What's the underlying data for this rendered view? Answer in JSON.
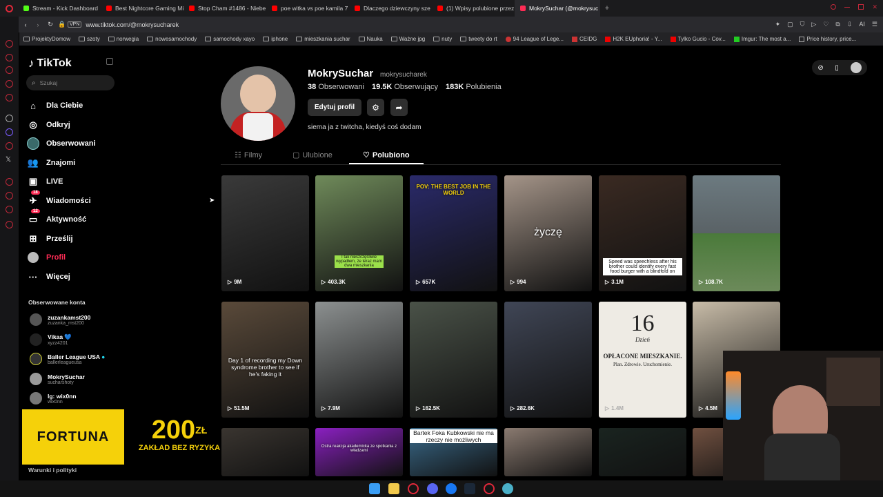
{
  "browser": {
    "tabs": [
      {
        "label": "Stream - Kick Dashboard",
        "color": "#53fc18"
      },
      {
        "label": "Best Nightcore Gaming Mi",
        "color": "#ff0000"
      },
      {
        "label": "Stop Cham #1486 - Niebe",
        "color": "#ff0000"
      },
      {
        "label": "poe witka vs poe kamila 7",
        "color": "#ff0000"
      },
      {
        "label": "Dlaczego dziewczyny sze",
        "color": "#ff0000"
      },
      {
        "label": "(1) Wpisy polubione przez",
        "color": "#ff0000"
      },
      {
        "label": "MokrySuchar (@mokrysuc",
        "color": "#fe2c55"
      }
    ],
    "new_tab": "+",
    "vpn": "VPN",
    "url": "www.tiktok.com/@mokrysucharek",
    "ai_label": "AI",
    "bookmarks": [
      "ProjektyDomow",
      "szoty",
      "norwegia",
      "nowesamochody",
      "samochody xayo",
      "iphone",
      "mieszkania suchar",
      "Nauka",
      "Ważne jpg",
      "nuty",
      "tweety do rt",
      "94 League of Lege...",
      "CEIDG",
      "H2K EUphoria! - Y...",
      "Tylko Gucio - Cov...",
      "Imgur: The most a...",
      "Price history, price..."
    ]
  },
  "sidebar": {
    "logo": "TikTok",
    "search_placeholder": "Szukaj",
    "nav": [
      {
        "label": "Dla Ciebie",
        "icon": "home-icon"
      },
      {
        "label": "Odkryj",
        "icon": "compass-icon"
      },
      {
        "label": "Obserwowani",
        "icon": "following-avatar-icon"
      },
      {
        "label": "Znajomi",
        "icon": "friends-icon"
      },
      {
        "label": "LIVE",
        "icon": "live-icon"
      },
      {
        "label": "Wiadomości",
        "icon": "messages-icon",
        "badge": "18"
      },
      {
        "label": "Aktywność",
        "icon": "activity-icon",
        "badge": "12"
      },
      {
        "label": "Prześlij",
        "icon": "upload-icon"
      },
      {
        "label": "Profil",
        "icon": "profile-icon"
      },
      {
        "label": "Więcej",
        "icon": "more-icon"
      }
    ],
    "followed_title": "Obserwowane konta",
    "followed": [
      {
        "name": "zuzankamst200",
        "sub": "zuzanka_mst200"
      },
      {
        "name": "Vikaa 💙",
        "sub": "xyzz4201"
      },
      {
        "name": "Baller League USA",
        "sub": "ballerleagueusa"
      },
      {
        "name": "MokrySuchar",
        "sub": "sucharshoty"
      },
      {
        "name": "lg: wix0nn",
        "sub": "wix0nn"
      }
    ],
    "footer": "Warunki i polityki"
  },
  "ad": {
    "brand": "FORTUNA",
    "amount": "200",
    "currency": "ZŁ",
    "tagline": "ZAKŁAD BEZ RYZYKA"
  },
  "profile": {
    "display_name": "MokrySuchar",
    "username": "mokrysucharek",
    "stats": [
      {
        "num": "38",
        "label": "Obserwowani"
      },
      {
        "num": "19.5K",
        "label": "Obserwujący"
      },
      {
        "num": "183K",
        "label": "Polubienia"
      }
    ],
    "edit_button": "Edytuj profil",
    "bio": "siema ja z twitcha, kiedyś coś dodam",
    "tabs": [
      "Filmy",
      "Ulubione",
      "Polubiono"
    ],
    "active_tab": "Polubiono"
  },
  "videos": [
    {
      "views": "9M",
      "caption": "",
      "bg": "#3a3a3a"
    },
    {
      "views": "403.3K",
      "caption": "",
      "bg": "#6f8a5a"
    },
    {
      "views": "657K",
      "caption": "POV: THE BEST JOB IN THE WORLD",
      "bg": "#2a2a6a"
    },
    {
      "views": "994",
      "caption": "życzę",
      "bg": "#a49488"
    },
    {
      "views": "3.1M",
      "caption": "Speed was speechless after his brother could identify every fast food burger with a blindfold on",
      "bg": "#3a2a22"
    },
    {
      "views": "108.7K",
      "caption": "",
      "bg": "#6c7a5a"
    },
    {
      "views": "51.5M",
      "caption": "Day 1 of recording my Down syndrome brother to see if he's faking it",
      "bg": "#5a4a3a"
    },
    {
      "views": "7.9M",
      "caption": "",
      "bg": "#8c9090"
    },
    {
      "views": "162.5K",
      "caption": "",
      "bg": "#4a5248"
    },
    {
      "views": "282.6K",
      "caption": "",
      "bg": "#404656"
    },
    {
      "views": "1.4M",
      "caption": "",
      "bg": "#eeebe4"
    },
    {
      "views": "4.5M",
      "caption": "",
      "bg": "#c8bca8"
    },
    {
      "views": "",
      "caption": "",
      "bg": "#3a3530"
    },
    {
      "views": "",
      "caption": "",
      "bg": "#8a20c0"
    },
    {
      "views": "",
      "caption": "Bartek Foka Kubkowski nie ma rzeczy nie możliwych",
      "bg": "#3a6a8a"
    },
    {
      "views": "",
      "caption": "",
      "bg": "#8a7a70"
    },
    {
      "views": "",
      "caption": "",
      "bg": "#1a2420"
    },
    {
      "views": "",
      "caption": "",
      "bg": "#705040"
    }
  ],
  "poster_16": {
    "num": "16",
    "day": "Dzień",
    "title": "OPŁACONE MIESZKANIE.",
    "sub": "Plan. Zdrowie. Uruchomienie."
  },
  "small_caption_2": "I tak nieszczęśliwie wypadłem, że teraz mam dwa mieszkania",
  "small_caption_14": "Ostra reakcja akademicka ze spotkania z władzami"
}
